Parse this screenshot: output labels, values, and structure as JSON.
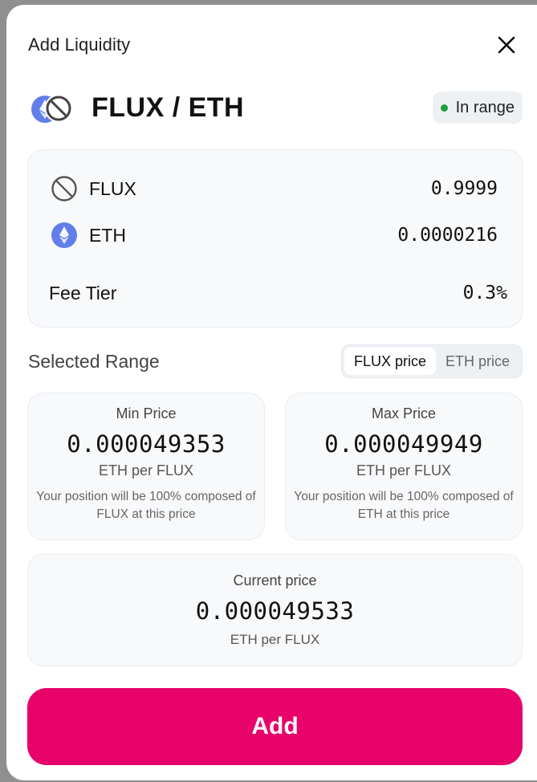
{
  "header": {
    "title": "Add Liquidity",
    "close_icon": "close-icon"
  },
  "pair": {
    "name": "FLUX / ETH",
    "status": "In range",
    "status_color": "#1b9e3e"
  },
  "tokens": [
    {
      "symbol": "FLUX",
      "amount": "0.9999",
      "icon": "flux-icon"
    },
    {
      "symbol": "ETH",
      "amount": "0.0000216",
      "icon": "eth-icon"
    }
  ],
  "fee": {
    "label": "Fee Tier",
    "value": "0.3%"
  },
  "range": {
    "title": "Selected Range",
    "toggle": {
      "options": [
        "FLUX price",
        "ETH price"
      ],
      "selected": "FLUX price"
    },
    "min": {
      "label": "Min Price",
      "value": "0.000049353",
      "unit": "ETH per FLUX",
      "note": "Your position will be 100% composed of FLUX at this price"
    },
    "max": {
      "label": "Max Price",
      "value": "0.000049949",
      "unit": "ETH per FLUX",
      "note": "Your position will be 100% composed of ETH at this price"
    }
  },
  "current": {
    "label": "Current price",
    "value": "0.000049533",
    "unit": "ETH per FLUX"
  },
  "actions": {
    "add_label": "Add",
    "add_color": "#e8036b"
  }
}
